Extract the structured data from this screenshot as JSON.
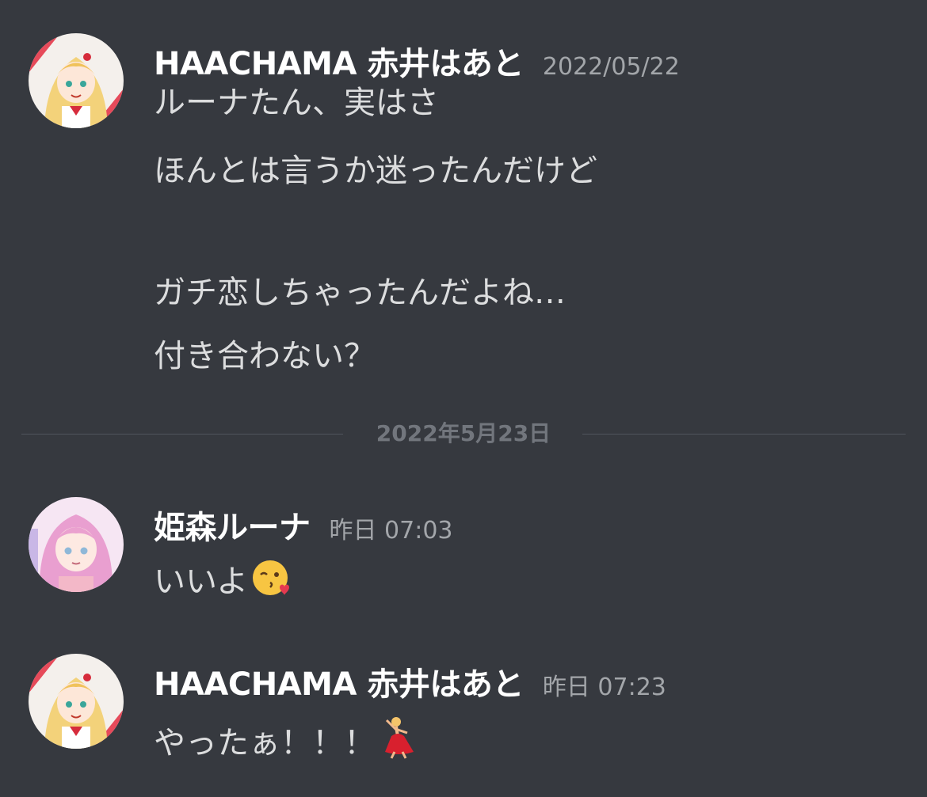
{
  "messages": [
    {
      "author": "HAACHAMA 赤井はあと",
      "timestamp": "2022/05/22",
      "avatar": "haachama-avatar",
      "lines": [
        "ルーナたん、実はさ",
        "ほんとは言うか迷ったんだけど",
        "ガチ恋しちゃったんだよね…",
        "付き合わない？"
      ]
    },
    {
      "author": "姫森ルーナ",
      "timestamp": "昨日 07:03",
      "avatar": "luna-avatar",
      "lines": [
        "いいよ"
      ],
      "emoji": "face-blowing-kiss-emoji"
    },
    {
      "author": "HAACHAMA 赤井はあと",
      "timestamp": "昨日 07:23",
      "avatar": "haachama-avatar",
      "lines": [
        "やったぁ！！！"
      ],
      "emoji": "woman-dancing-emoji"
    }
  ],
  "divider": {
    "label": "2022年5月23日"
  },
  "colors": {
    "background": "#36393f",
    "author": "#ffffff",
    "text": "#dcddde",
    "timestamp": "#a3a6aa",
    "divider_line": "#4f545c",
    "divider_text": "#72767d"
  }
}
